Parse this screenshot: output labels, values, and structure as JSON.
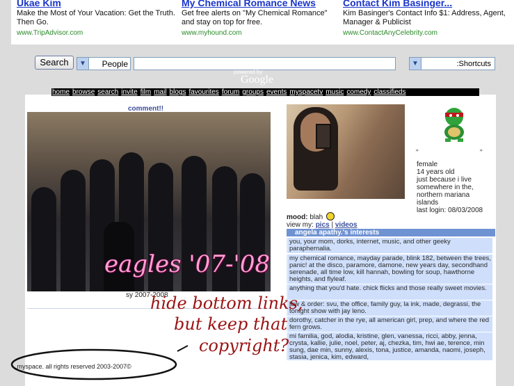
{
  "ads": [
    {
      "title": "Ukae Kim",
      "text": "Make the Most of Your Vacation: Get the Truth. Then Go.",
      "url": "www.TripAdvisor.com"
    },
    {
      "title": "My Chemical Romance News",
      "text": "Get free alerts on \"My Chemical Romance\" and stay on top for free.",
      "url": "www.myhound.com"
    },
    {
      "title": "Contact Kim Basinger...",
      "text": "Kim Basinger's Contact Info $1: Address, Agent, Manager & Publicist",
      "url": "www.ContactAnyCelebrity.com"
    }
  ],
  "search": {
    "button_label": "Search",
    "category": "People",
    "input_value": "",
    "shortcuts_label": ":Shortcuts",
    "powered_by": "powered by",
    "google": "Google"
  },
  "navbar": [
    "home",
    "browse",
    "search",
    "invite",
    "film",
    "mail",
    "blogs",
    "favourites",
    "forum",
    "groups",
    "events",
    "myspacetv",
    "music",
    "comedy",
    "classifieds"
  ],
  "left": {
    "comment_link": "comment!!",
    "banner_text": "eagles '07-'08",
    "caption": "sy 2007-2008"
  },
  "profile": {
    "quote_open": "\"",
    "quote_close": "\"",
    "gender": "female",
    "age": "14 years old",
    "location_note": "just because i live somewhere in the,",
    "region": "northern mariana islands",
    "last_login": "last login: 08/03/2008",
    "mood_label": "mood:",
    "mood_value": "blah",
    "viewmy_label": "view my:",
    "pics_label": "pics",
    "videos_label": "videos"
  },
  "interests": {
    "header": "angela apathy.'s interests",
    "rows": [
      "you, your mom, dorks, internet, music, and other geeky paraphernalia.",
      "my chemical romance, mayday parade, blink 182, between the trees, panic! at the disco, paramore, damone, new years day, secondhand serenade, all time low, kill hannah, bowling for soup, hawthorne heights, and flyleaf.",
      "anything that you'd hate. chick flicks and those really sweet movies.",
      "law & order: svu, the office, family guy, la ink, made, degrassi, the tonight show with jay leno.",
      "dorothy, catcher in the rye, all american girl, prep, and where the red fern grows.",
      "mi familia, god, alodia, kristine, glen, vanessa, ricci, abby, jenna, crysta, kallie, julie, noel, peter, aj, chezka, tim, hwi ae, terence, min sung, dae min, sunny, alexis, tona, justice, amanda, naomi, joseph, stasia, jenica, kim, edward,"
    ]
  },
  "copyright": ".myspace. all rights reserved 2003-2007©",
  "annotation": {
    "line1": "hide bottom links,",
    "line2": "but keep that",
    "line3": "copyright?"
  },
  "colors": {
    "nav_bg": "#000000",
    "interest_header": "#6f92d3",
    "interest_cell": "#cfdffb",
    "annotation": "#9a1212",
    "link": "#3b4e9a"
  }
}
